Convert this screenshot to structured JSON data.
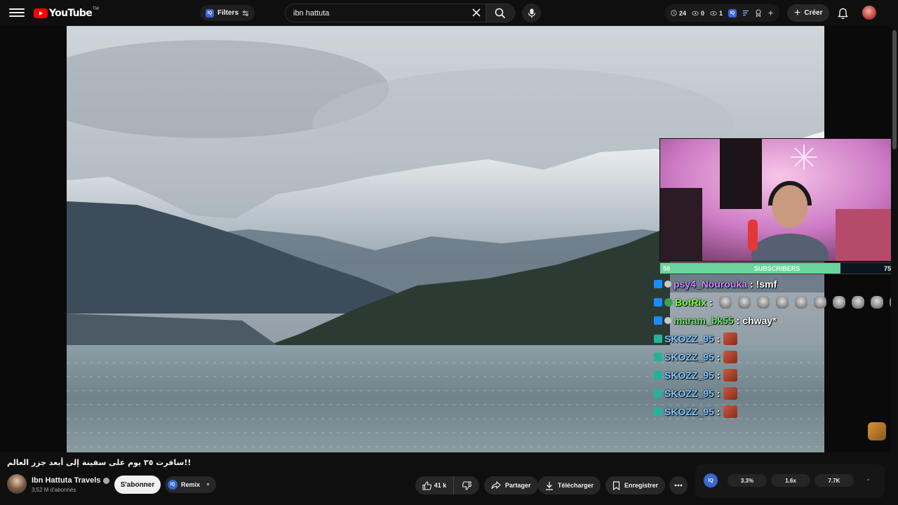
{
  "app": {
    "logo_text": "YouTube",
    "logo_tm": "TM"
  },
  "header": {
    "filters_label": "Filters",
    "filters_iq": "IQ",
    "search_value": "ibn hattuta",
    "stats": [
      {
        "icon": "clock-icon",
        "value": "24"
      },
      {
        "icon": "eye-icon",
        "value": "0"
      },
      {
        "icon": "eye-icon",
        "value": "1"
      }
    ],
    "create_label": "Créer"
  },
  "stream": {
    "sub_goal": {
      "current": "58",
      "label": "SUBSCRIBERS",
      "goal": "75",
      "progress": 0.773
    },
    "chat": [
      {
        "badge": "prime",
        "user": "psy4_Nourouka",
        "user_color": "#c48aff",
        "sep": ":",
        "msg": "!smf",
        "emotes": 0
      },
      {
        "badge": "prime",
        "user": "BotRix",
        "user_color": "#7dff52",
        "sep": ":",
        "msg": "",
        "emotes": 10
      },
      {
        "badge": "prime",
        "user": "maram_bk55",
        "user_color": "#6de36d",
        "sep": ":",
        "msg": "chway*",
        "emotes": 0
      },
      {
        "badge": "prime-sub",
        "user": "SKOZZ_95",
        "user_color": "#7ec6ff",
        "sep": ":",
        "msg": "",
        "emotes": 1
      },
      {
        "badge": "prime-sub",
        "user": "SKOZZ_95",
        "user_color": "#7ec6ff",
        "sep": ":",
        "msg": "",
        "emotes": 1
      },
      {
        "badge": "prime-sub",
        "user": "SKOZZ_95",
        "user_color": "#7ec6ff",
        "sep": ":",
        "msg": "",
        "emotes": 1
      },
      {
        "badge": "prime-sub",
        "user": "SKOZZ_95",
        "user_color": "#7ec6ff",
        "sep": ":",
        "msg": "",
        "emotes": 1
      },
      {
        "badge": "prime-sub",
        "user": "SKOZZ_95",
        "user_color": "#7ec6ff",
        "sep": ":",
        "msg": "",
        "emotes": 1
      }
    ]
  },
  "video": {
    "title": "!!سافرت ٣٥ يوم على سفينة إلى أبعد جزر العالم",
    "channel_name": "Ibn Hattuta Travels",
    "subscribers": "3,52 M d'abonnés",
    "subscribe_label": "S'abonner",
    "remix_label": "Remix",
    "remix_iq": "IQ",
    "likes": "41 k",
    "share_label": "Partager",
    "download_label": "Télécharger",
    "save_label": "Enregistrer"
  },
  "extension": {
    "iq": "IQ",
    "values": [
      "3.3%",
      "1.6x",
      "7.7K"
    ]
  },
  "colors": {
    "background": "#0f0f0f",
    "brand_red": "#ff0000",
    "sub_goal_fill": "#6bd49c",
    "iq_blue": "#3867d6"
  }
}
